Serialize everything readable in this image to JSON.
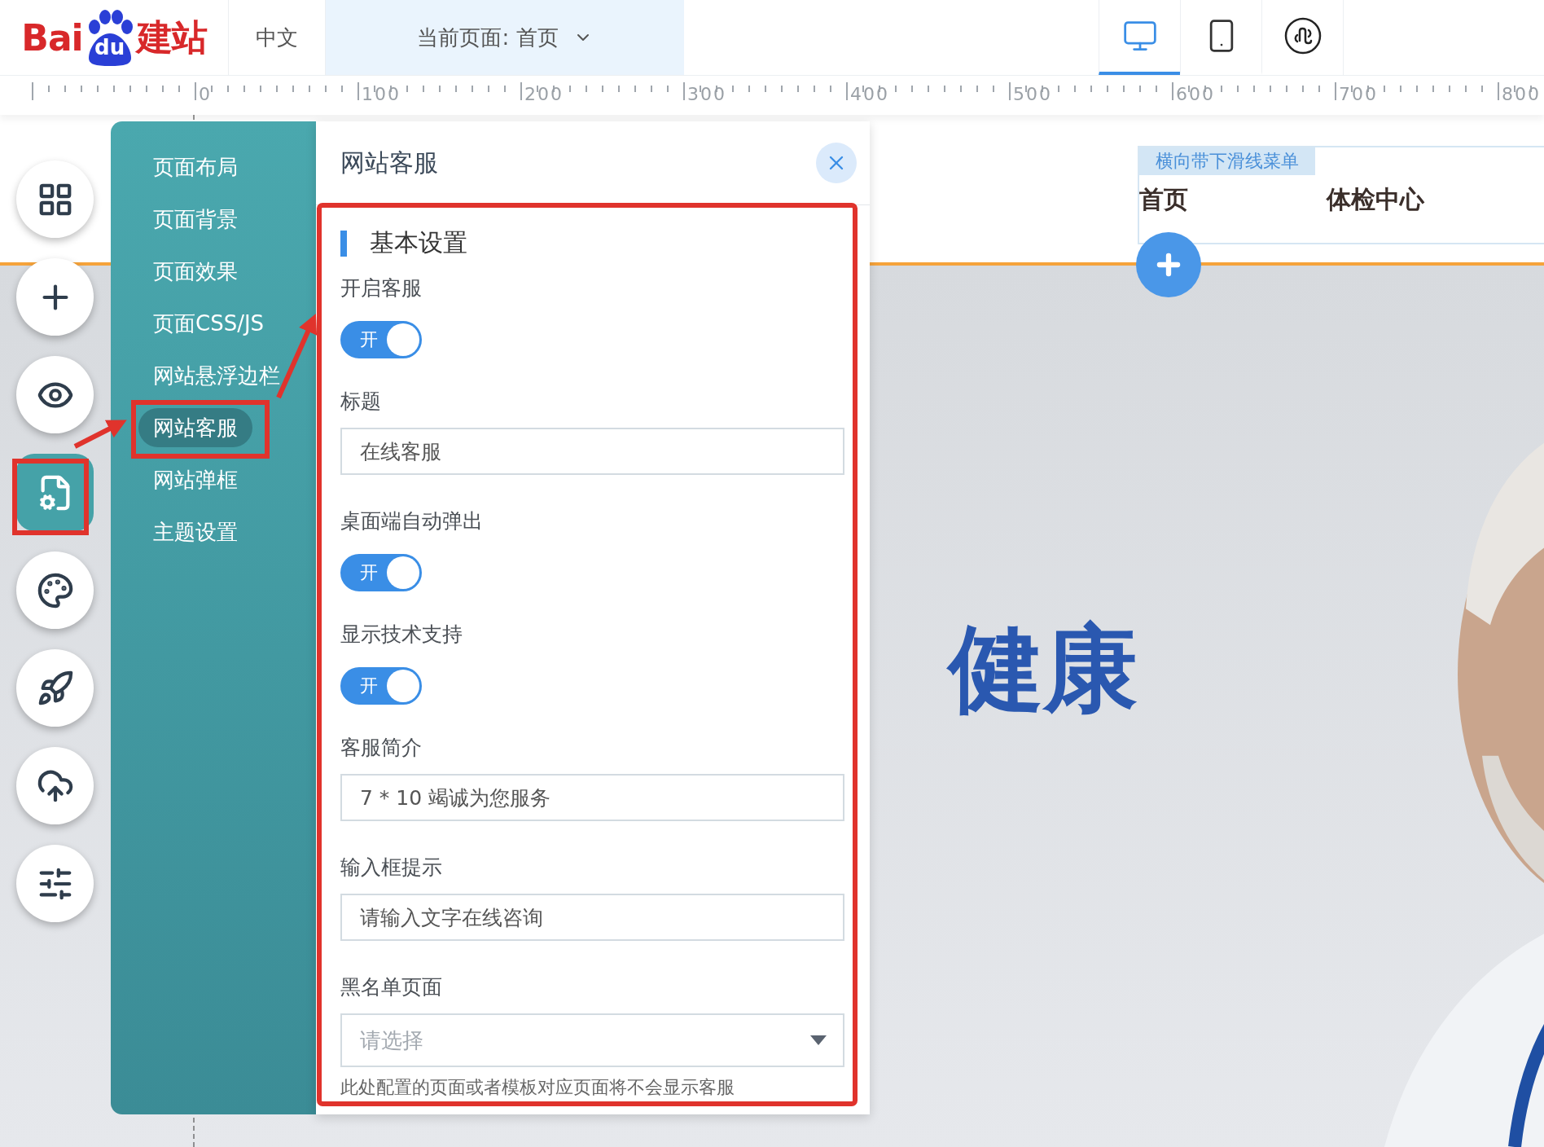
{
  "header": {
    "logo": [
      "Bai",
      "du",
      "建站"
    ],
    "language_tab": "中文",
    "page_selector": "当前页面: 首页",
    "devices": [
      {
        "kind": "desktop",
        "selected": true
      },
      {
        "kind": "mobile",
        "selected": false
      },
      {
        "kind": "miniprogram",
        "selected": false
      }
    ]
  },
  "ruler": [
    "0",
    "100",
    "200",
    "300",
    "400",
    "500",
    "600",
    "700",
    "800"
  ],
  "tool_buttons": [
    {
      "kind": "grid",
      "selected": false
    },
    {
      "kind": "add",
      "selected": false
    },
    {
      "kind": "preview",
      "selected": false
    },
    {
      "kind": "page_settings",
      "selected": true
    },
    {
      "kind": "theme",
      "selected": false
    },
    {
      "kind": "publish",
      "selected": false
    },
    {
      "kind": "upload",
      "selected": false
    },
    {
      "kind": "controls",
      "selected": false
    }
  ],
  "settings_menu": [
    {
      "label": "页面布局",
      "selected": false
    },
    {
      "label": "页面背景",
      "selected": false
    },
    {
      "label": "页面效果",
      "selected": false
    },
    {
      "label": "页面CSS/JS",
      "selected": false
    },
    {
      "label": "网站悬浮边栏",
      "selected": false
    },
    {
      "label": "网站客服",
      "selected": true
    },
    {
      "label": "网站弹框",
      "selected": false
    },
    {
      "label": "主题设置",
      "selected": false
    }
  ],
  "dialog": {
    "title": "网站客服",
    "section": "基本设置",
    "fields": [
      {
        "kind": "toggle",
        "label": "开启客服",
        "on": true,
        "toggle_text": "开"
      },
      {
        "kind": "text",
        "label": "标题",
        "value": "在线客服"
      },
      {
        "kind": "toggle",
        "label": "桌面端自动弹出",
        "on": true,
        "toggle_text": "开"
      },
      {
        "kind": "toggle",
        "label": "显示技术支持",
        "on": true,
        "toggle_text": "开"
      },
      {
        "kind": "text",
        "label": "客服简介",
        "value": "7 * 10 竭诚为您服务"
      },
      {
        "kind": "text",
        "label": "输入框提示",
        "value": "请输入文字在线咨询"
      },
      {
        "kind": "select",
        "label": "黑名单页面",
        "placeholder": "请选择",
        "hint": "此处配置的页面或者模板对应页面将不会显示客服"
      }
    ]
  },
  "canvas": {
    "menu_widget": {
      "tag": "横向带下滑线菜单",
      "items": [
        "首页",
        "体检中心"
      ]
    },
    "banner_text": "健康"
  }
}
